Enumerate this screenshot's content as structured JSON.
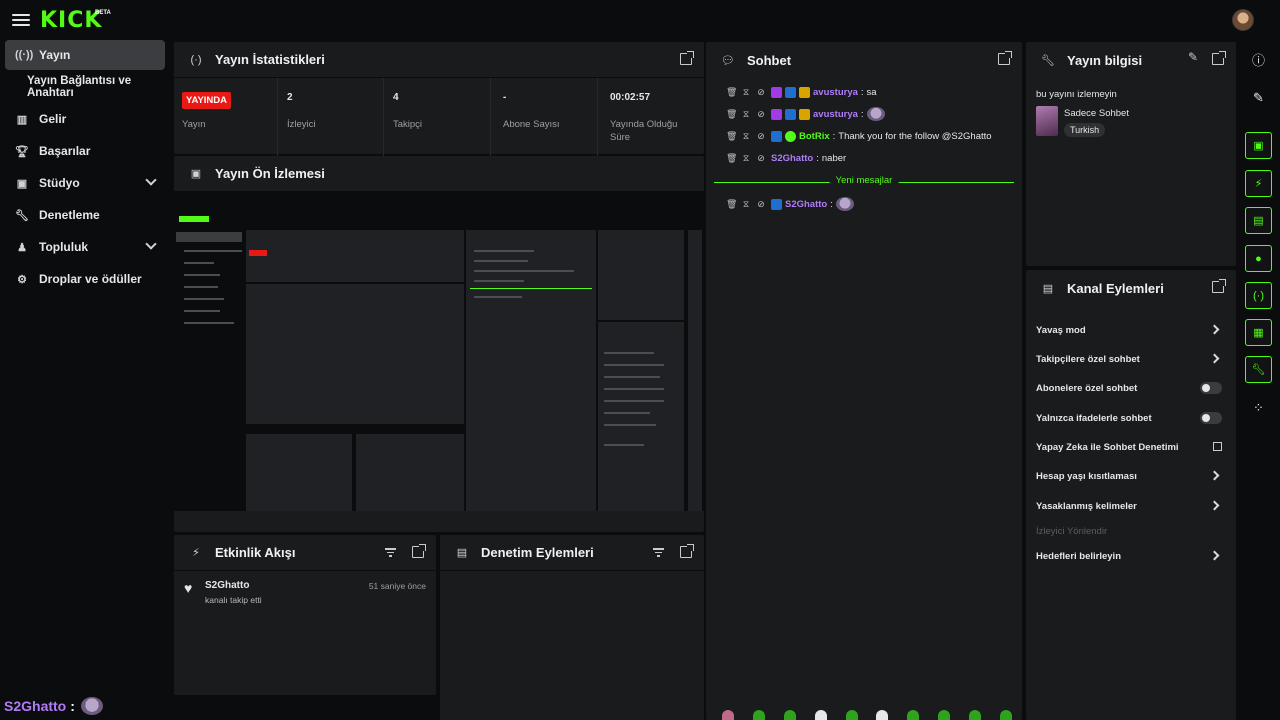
{
  "topbar": {
    "logo": "KICK",
    "logo_badge": "BETA"
  },
  "sidebar": {
    "items": [
      {
        "label": "Yayın",
        "icon": "broadcast-icon"
      },
      {
        "label": "Yayın Bağlantısı ve Anahtarı"
      },
      {
        "label": "Gelir",
        "icon": "chart-icon"
      },
      {
        "label": "Başarılar",
        "icon": "trophy-icon"
      },
      {
        "label": "Stüdyo",
        "icon": "studio-icon"
      },
      {
        "label": "Denetleme",
        "icon": "wrench-icon"
      },
      {
        "label": "Topluluk",
        "icon": "community-icon"
      },
      {
        "label": "Droplar ve ödüller",
        "icon": "drops-icon"
      }
    ]
  },
  "stats": {
    "title": "Yayın İstatistikleri",
    "cells": [
      {
        "value": "YAYINDA",
        "label": "Yayın"
      },
      {
        "value": "2",
        "label": "İzleyici"
      },
      {
        "value": "4",
        "label": "Takipçi"
      },
      {
        "value": "-",
        "label": "Abone Sayısı"
      },
      {
        "value": "00:02:57",
        "label": "Yayında Olduğu Süre"
      }
    ]
  },
  "preview": {
    "title": "Yayın Ön İzlemesi"
  },
  "activity": {
    "title": "Etkinlik Akışı",
    "events": [
      {
        "user": "S2Ghatto",
        "action": "kanalı takip etti",
        "time": "51 saniye önce"
      }
    ]
  },
  "moderation_log": {
    "title": "Denetim Eylemleri"
  },
  "chat": {
    "title": "Sohbet",
    "messages": [
      {
        "user": "avusturya",
        "text": "sa",
        "color": "#b07cf7"
      },
      {
        "user": "avusturya",
        "text": "",
        "color": "#b07cf7"
      },
      {
        "user": "BotRix",
        "text": "Thank you for the follow @S2Ghatto",
        "color": "#53fc18"
      },
      {
        "user": "S2Ghatto",
        "text": "naber",
        "color": "#b07cf7"
      }
    ],
    "new_messages_label": "Yeni mesajlar",
    "new_messages": [
      {
        "user": "S2Ghatto",
        "text": "",
        "color": "#b07cf7"
      }
    ]
  },
  "stream_info": {
    "title": "Yayın bilgisi",
    "stream_title": "bu yayını izlemeyin",
    "category": "Sadece Sohbet",
    "language": "Turkish"
  },
  "channel_actions": {
    "title": "Kanal Eylemleri",
    "rows": [
      {
        "label": "Yavaş mod",
        "control": "arrow"
      },
      {
        "label": "Takipçilere özel sohbet",
        "control": "arrow"
      },
      {
        "label": "Abonelere özel sohbet",
        "control": "toggle"
      },
      {
        "label": "Yalnızca ifadelerle sohbet",
        "control": "toggle"
      },
      {
        "label": "Yapay Zeka ile Sohbet Denetimi",
        "control": "external"
      },
      {
        "label": "Hesap yaşı kısıtlaması",
        "control": "arrow"
      },
      {
        "label": "Yasaklanmış kelimeler",
        "control": "arrow"
      },
      {
        "label": "İzleyici Yönlendir",
        "control": "disabled"
      },
      {
        "label": "Hedefleri belirleyin",
        "control": "arrow"
      }
    ]
  },
  "bottom_overlay": {
    "user": "S2Ghatto",
    "separator": ":"
  },
  "colors": {
    "accent": "#53fc18",
    "live": "#e91916",
    "username": "#b07cf7",
    "panel": "#191b1d",
    "background": "#0b0c0d"
  }
}
